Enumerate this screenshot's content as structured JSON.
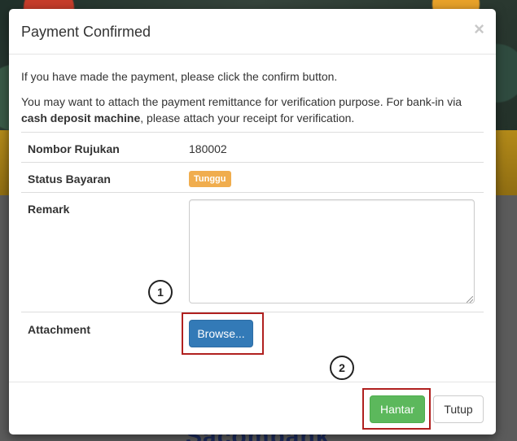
{
  "background": {
    "partial_text": "Sacombank"
  },
  "modal": {
    "title": "Payment Confirmed",
    "close_symbol": "×",
    "intro_line_1": "If you have made the payment, please click the confirm button.",
    "intro_line_2_part1": "You may want to attach the payment remittance for verification purpose. For bank-in via ",
    "intro_line_2_bold": "cash deposit machine",
    "intro_line_2_part2": ", please attach your receipt for verification.",
    "fields": {
      "ref_label": "Nombor Rujukan",
      "ref_value": "180002",
      "status_label": "Status Bayaran",
      "status_badge": "Tunggu",
      "status_badge_color": "#f0ad4e",
      "remark_label": "Remark",
      "remark_value": "",
      "attachment_label": "Attachment",
      "browse_label": "Browse..."
    },
    "callouts": {
      "one": "1",
      "two": "2"
    },
    "footer": {
      "submit_label": "Hantar",
      "submit_color": "#5cb85c",
      "close_label": "Tutup"
    },
    "highlight_color": "#b0201f"
  }
}
